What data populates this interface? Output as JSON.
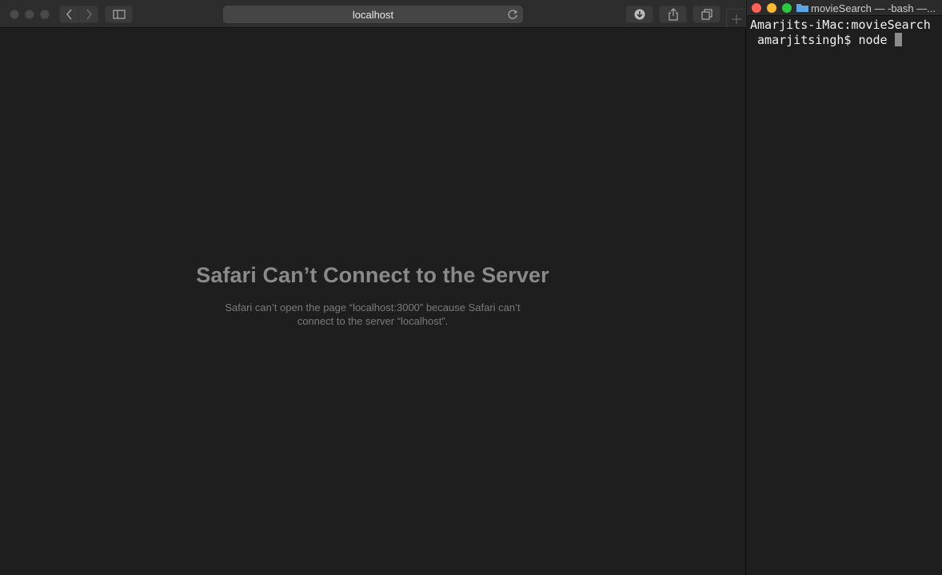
{
  "safari": {
    "address": "localhost",
    "error_title": "Safari Can’t Connect to the Server",
    "error_message": "Safari can’t open the page “localhost:3000” because Safari can’t connect to the server “localhost”.",
    "icons": [
      "back-icon",
      "forward-icon",
      "sidebar-icon",
      "reload-icon",
      "download-icon",
      "share-icon",
      "tabs-icon",
      "plus-icon"
    ]
  },
  "terminal": {
    "title": "movieSearch — -bash —...",
    "prompt_line1": "Amarjits-iMac:movieSearch",
    "prompt_line2": " amarjitsingh$ node ",
    "colors": {
      "close": "#ff5f57",
      "minimize": "#febc2e",
      "zoom": "#28c840"
    }
  }
}
